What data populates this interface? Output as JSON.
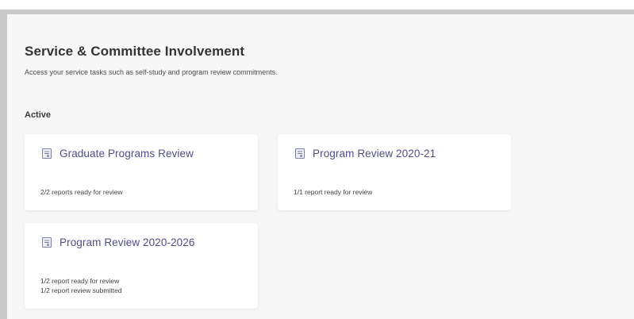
{
  "page": {
    "title": "Service & Committee Involvement",
    "description": "Access your service tasks such as self-study and program review commitments.",
    "section_heading": "Active"
  },
  "cards": [
    {
      "title": "Graduate Programs Review",
      "icon": "document-icon",
      "status_lines": [
        "2/2 reports ready for review"
      ]
    },
    {
      "title": "Program Review 2020-21",
      "icon": "document-icon",
      "status_lines": [
        "1/1 report ready for review"
      ]
    },
    {
      "title": "Program Review 2020-2026",
      "icon": "document-icon",
      "status_lines": [
        "1/2 report ready for review",
        "1/2 report review submitted"
      ]
    }
  ],
  "colors": {
    "accent": "#4f4c8f",
    "panel_background": "#f7f7f7",
    "frame": "#c9c9c9"
  }
}
